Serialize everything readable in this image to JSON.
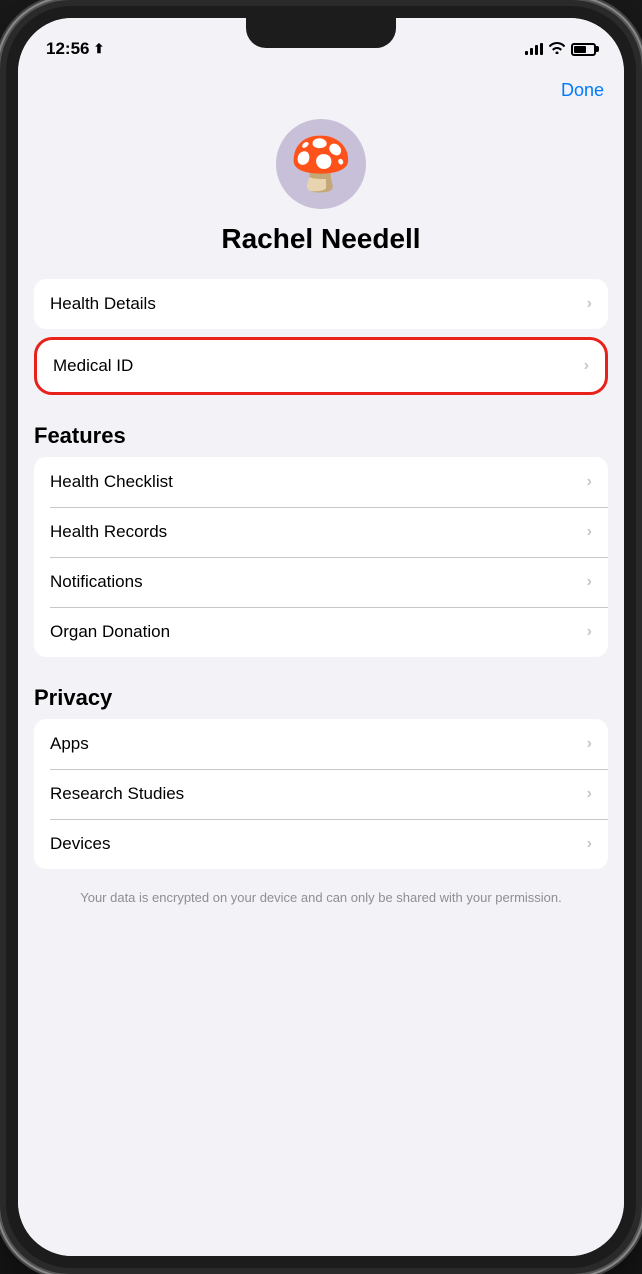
{
  "status": {
    "time": "12:56",
    "location_icon": "⬆",
    "battery_percent": 65
  },
  "header": {
    "done_label": "Done"
  },
  "profile": {
    "avatar_emoji": "🍄",
    "name": "Rachel Needell"
  },
  "top_section": {
    "items": [
      {
        "label": "Health Details",
        "chevron": "›"
      }
    ]
  },
  "medical_id": {
    "label": "Medical ID",
    "chevron": "›"
  },
  "features_section": {
    "header": "Features",
    "items": [
      {
        "label": "Health Checklist",
        "chevron": "›"
      },
      {
        "label": "Health Records",
        "chevron": "›"
      },
      {
        "label": "Notifications",
        "chevron": "›"
      },
      {
        "label": "Organ Donation",
        "chevron": "›"
      }
    ]
  },
  "privacy_section": {
    "header": "Privacy",
    "items": [
      {
        "label": "Apps",
        "chevron": "›"
      },
      {
        "label": "Research Studies",
        "chevron": "›"
      },
      {
        "label": "Devices",
        "chevron": "›"
      }
    ]
  },
  "footer": {
    "text": "Your data is encrypted on your device and can only be shared with your permission."
  }
}
